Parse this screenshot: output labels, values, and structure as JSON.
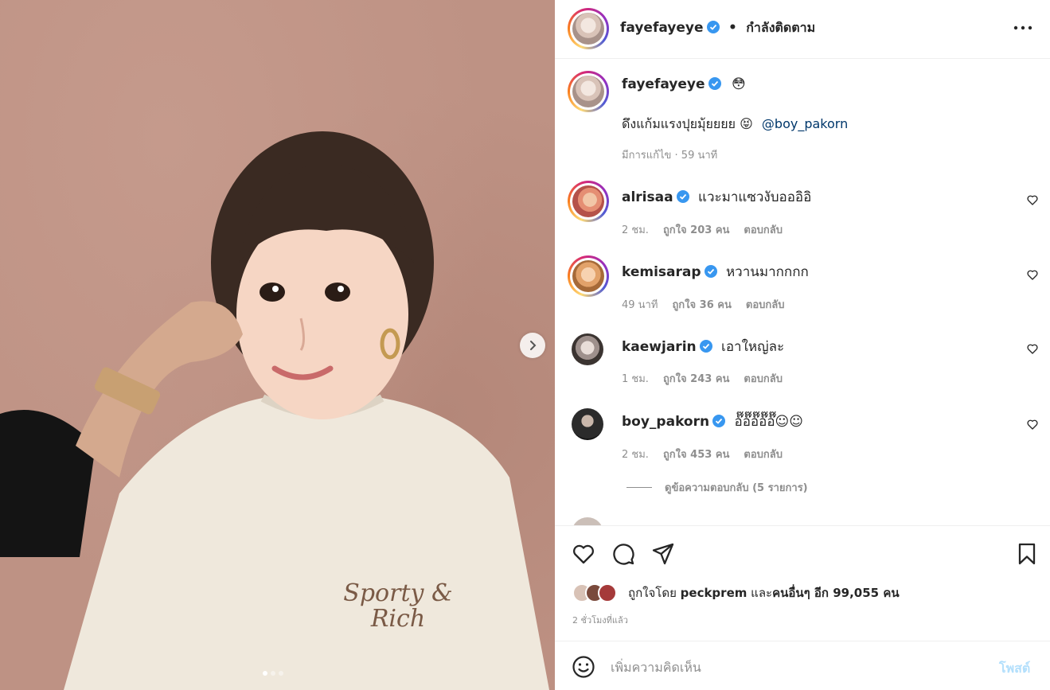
{
  "colors": {
    "verified": "#3897f0",
    "link": "#00376b",
    "muted": "#8e8e8e",
    "post_disabled": "#b2dffc"
  },
  "photo": {
    "print_text_1": "Sporty &",
    "print_text_2": "Rich",
    "next_icon": "chevron-right-icon",
    "carousel_count": 3,
    "carousel_active": 1
  },
  "header": {
    "username": "fayefayeye",
    "separator": "•",
    "follow_status": "กำลังติดตาม",
    "more_icon": "more-options-icon"
  },
  "caption": {
    "username": "fayefayeye",
    "username_emoji": "😳",
    "text": "ดึงแก้มแรงปุยมุ้ยยยย 😝",
    "mention": "@boy_pakorn",
    "meta": "มีการแก้ไข · 59 นาที"
  },
  "comments": [
    {
      "username": "alrisaa",
      "text": "แวะมาแซวงับอออิอิ",
      "time": "2 ชม.",
      "likes": "ถูกใจ 203 คน",
      "reply": "ตอบกลับ"
    },
    {
      "username": "kemisarap",
      "text": "หวานมากกกก",
      "time": "49 นาที",
      "likes": "ถูกใจ 36 คน",
      "reply": "ตอบกลับ"
    },
    {
      "username": "kaewjarin",
      "text": "เอาใหญ่ละ",
      "time": "1 ชม.",
      "likes": "ถูกใจ 243 คน",
      "reply": "ตอบกลับ"
    },
    {
      "username": "boy_pakorn",
      "text": "อ๊๊อ๊๊อ๊๊อ๊๊อ๊๊☺︎☺︎",
      "time": "2 ชม.",
      "likes": "ถูกใจ 453 คน",
      "reply": "ตอบกลับ"
    }
  ],
  "view_replies": "ดูข้อความตอบกลับ (5 รายการ)",
  "likes": {
    "prefix": "ถูกใจโดย",
    "liker": "peckprem",
    "middle": "และ",
    "others": "คนอื่นๆ อีก 99,055 คน"
  },
  "time_ago": "2 ชั่วโมงที่แล้ว",
  "comment_box": {
    "placeholder": "เพิ่มความคิดเห็น",
    "post_label": "โพสต์"
  }
}
